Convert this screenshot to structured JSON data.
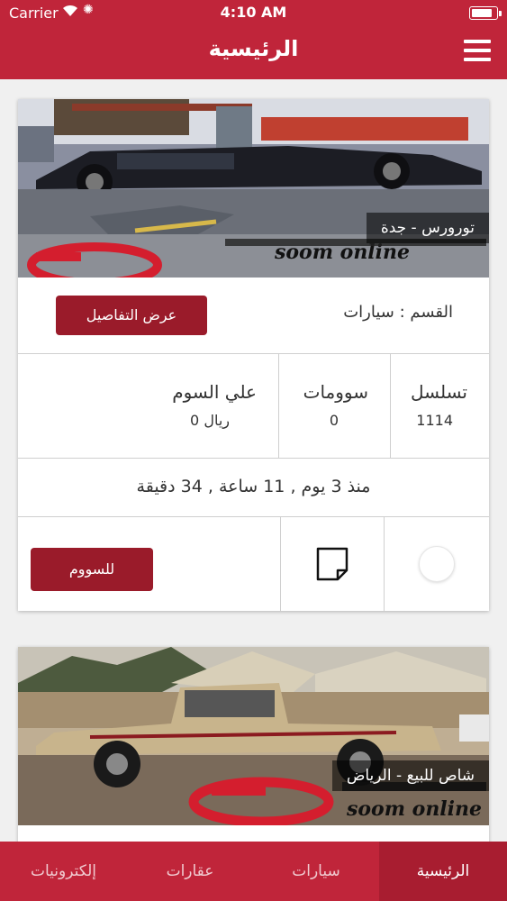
{
  "status_bar": {
    "carrier": "Carrier",
    "time": "4:10 AM",
    "battery_level": 0.85
  },
  "nav": {
    "title": "الرئيسية"
  },
  "listings": [
    {
      "caption": "تورورس - جدة",
      "watermark_text": "سوم اونلاين soom online",
      "category": "القسم : سيارات",
      "details_label": "عرض التفاصيل",
      "serial_label": "تسلسل",
      "serial_value": "1114",
      "bids_label": "سوومات",
      "bids_value": "0",
      "highest_label": "علي السوم",
      "highest_value": "0 ريال",
      "time_ago": "منذ 3 يوم , 11 ساعة , 34 دقيقة",
      "bid_label": "للسووم"
    },
    {
      "caption": "شاص للبيع - الرياض",
      "watermark_text": "سوم اونلاين soom online"
    }
  ],
  "tabs": {
    "home": "الرئيسية",
    "cars": "سيارات",
    "realestate": "عقارات",
    "electronics": "إلكترونيات"
  },
  "colors": {
    "brand": "#c0253a",
    "button": "#9a1b2a",
    "tab_active": "#a81d30"
  },
  "icons": {
    "menu": "hamburger-icon",
    "note": "note-icon",
    "wifi": "wifi-icon",
    "battery": "battery-icon"
  }
}
